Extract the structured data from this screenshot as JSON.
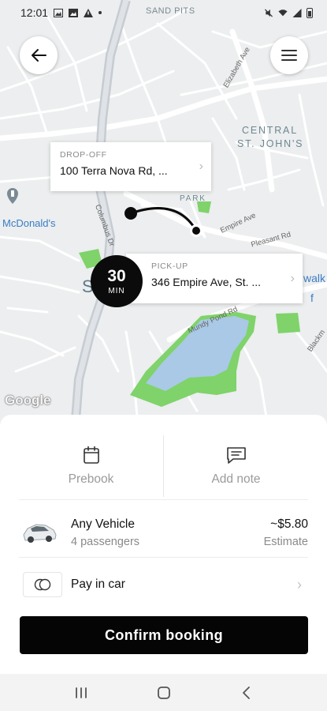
{
  "status_bar": {
    "time": "12:01"
  },
  "map": {
    "labels": {
      "sand_pits": "SAND PITS",
      "central_st_johns_1": "CENTRAL",
      "central_st_johns_2": "ST. JOHN'S",
      "park": "PARK",
      "elizabeth_ave": "Elizabeth Ave",
      "empire_ave": "Empire Ave",
      "pleasant_rd": "Pleasant Rd",
      "columbus_dr": "Columbus Dr",
      "mundy_pond_rd": "Mundy Pond Rd",
      "blackmarsh": "Blackm",
      "walk": "walk",
      "mcdonalds": "McDonald's",
      "s_letter": "S",
      "f_letter": "f",
      "google": "Google"
    },
    "dropoff": {
      "kicker": "DROP-OFF",
      "address": "100 Terra Nova Rd, ..."
    },
    "pickup": {
      "kicker": "PICK-UP",
      "address": "346 Empire Ave, St. ..."
    },
    "eta": {
      "value": "30",
      "unit": "MIN"
    }
  },
  "sheet": {
    "prebook_label": "Prebook",
    "add_note_label": "Add note",
    "vehicle": {
      "name": "Any Vehicle",
      "passengers": "4 passengers",
      "price": "~$5.80",
      "price_note": "Estimate"
    },
    "payment": {
      "label": "Pay in car"
    },
    "confirm_label": "Confirm booking"
  },
  "icons": {
    "back": "arrow-left-icon",
    "menu": "hamburger-menu-icon",
    "prebook": "calendar-icon",
    "note": "message-icon",
    "car": "car-icon",
    "payment": "cash-icon"
  },
  "colors": {
    "accent": "#0b0b0b",
    "park": "#7fd36a",
    "water": "#a9c9e6"
  }
}
